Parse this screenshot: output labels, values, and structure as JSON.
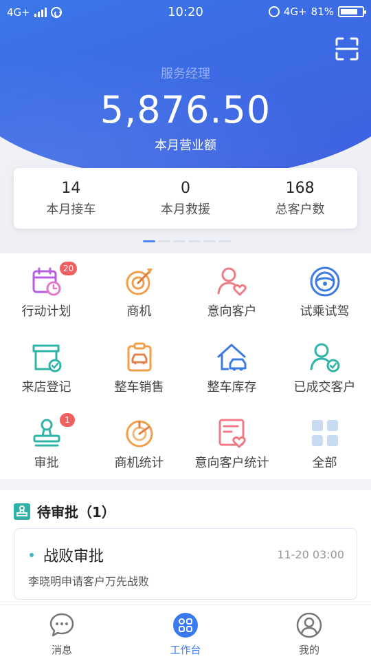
{
  "status_bar": {
    "network": "4G+",
    "time": "10:20",
    "network_right": "4G+",
    "battery": "81%",
    "battery_level": 0.81
  },
  "header": {
    "role": "服务经理",
    "amount": "5,876.50",
    "amount_label": "本月营业额",
    "scan_icon": "scan-icon"
  },
  "stats": [
    {
      "value": "14",
      "label": "本月接车"
    },
    {
      "value": "0",
      "label": "本月救援"
    },
    {
      "value": "168",
      "label": "总客户数"
    }
  ],
  "pager": {
    "pages": 6,
    "active": 0
  },
  "menu": [
    {
      "label": "行动计划",
      "icon": "calendar-icon",
      "badge": "20"
    },
    {
      "label": "商机",
      "icon": "target-icon"
    },
    {
      "label": "意向客户",
      "icon": "user-heart-icon"
    },
    {
      "label": "试乘试驾",
      "icon": "steering-wheel-icon"
    },
    {
      "label": "来店登记",
      "icon": "store-check-icon"
    },
    {
      "label": "整车销售",
      "icon": "car-clipboard-icon"
    },
    {
      "label": "整车库存",
      "icon": "car-house-icon"
    },
    {
      "label": "已成交客户",
      "icon": "user-check-icon"
    },
    {
      "label": "审批",
      "icon": "stamp-icon",
      "badge": "1"
    },
    {
      "label": "商机统计",
      "icon": "pie-chart-icon"
    },
    {
      "label": "意向客户统计",
      "icon": "report-heart-icon"
    },
    {
      "label": "全部",
      "icon": "grid-icon"
    }
  ],
  "approval": {
    "title": "待审批（1）",
    "item": {
      "title": "战败审批",
      "time": "11-20 03:00",
      "desc": "李晓明申请客户万先战败"
    }
  },
  "tabs": [
    {
      "label": "消息",
      "icon": "chat-icon"
    },
    {
      "label": "工作台",
      "icon": "workbench-icon"
    },
    {
      "label": "我的",
      "icon": "profile-icon"
    }
  ],
  "colors": {
    "primary": "#3a7af0",
    "badge": "#f06060",
    "accent_teal": "#3bb8c7"
  }
}
